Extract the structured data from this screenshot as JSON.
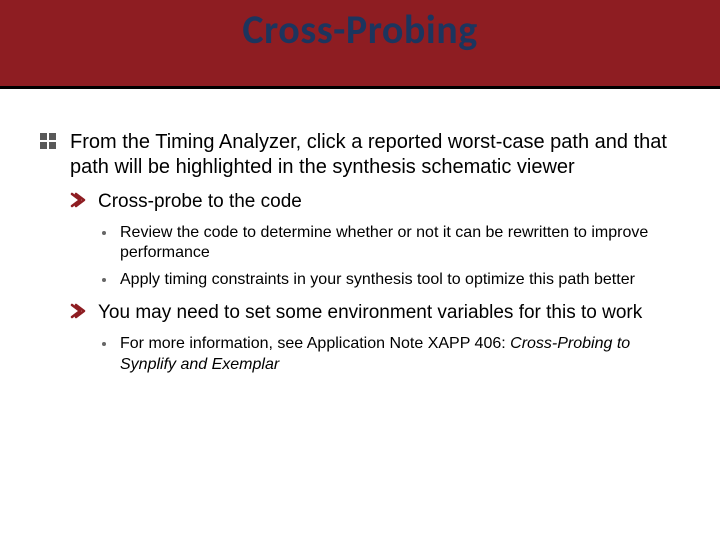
{
  "title": "Cross-Probing",
  "lvl1_text": "From the Timing Analyzer, click a reported worst-case path and that path will be highlighted in the synthesis schematic viewer",
  "lvl2_a": "Cross-probe to the code",
  "lvl3_a1": "Review the code to determine whether or not it can be rewritten to improve performance",
  "lvl3_a2": "Apply timing constraints in your synthesis tool to optimize this path better",
  "lvl2_b": "You may need to set some environment variables for this to work",
  "lvl3_b1_prefix": "For more information, see Application Note XAPP 406: ",
  "lvl3_b1_italic": "Cross-Probing to Synplify and Exemplar"
}
